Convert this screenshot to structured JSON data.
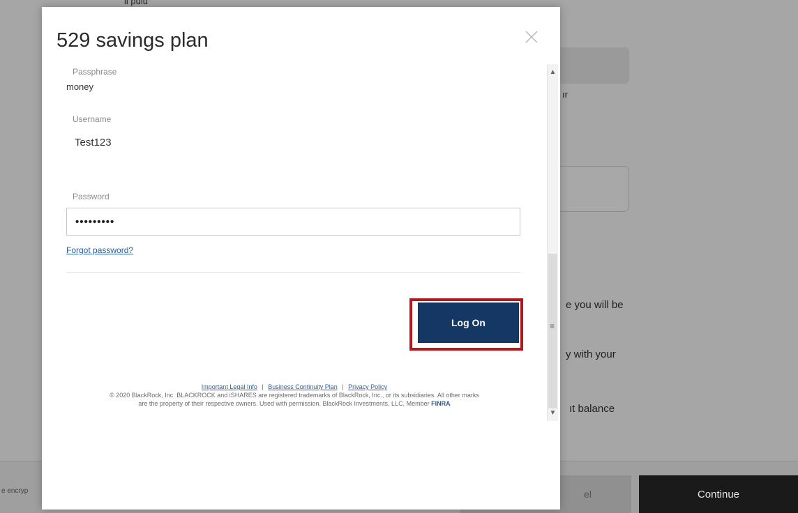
{
  "background": {
    "top_fragment": "ll pulu",
    "fragment_1": "ır",
    "fragment_2": "e you will be",
    "fragment_3": "y with your",
    "fragment_4": "ıt balance",
    "footer_left_fragment": "e encryp",
    "secondary_button_fragment": "el",
    "continue_label": "Continue"
  },
  "modal": {
    "title": "529 savings plan",
    "passphrase_label": "Passphrase",
    "passphrase_value": "money",
    "username_label": "Username",
    "username_value": "Test123",
    "password_label": "Password",
    "password_value": "•••••••••",
    "forgot_password": "Forgot password?",
    "logon_button": "Log On",
    "legal": {
      "link_1": "Important Legal Info",
      "link_2": "Business Continuity Plan",
      "link_3": "Privacy Policy",
      "separator": "|",
      "line_1": "© 2020 BlackRock, Inc. BLACKROCK and iSHARES are registered trademarks of BlackRock, Inc., or its subsidiaries. All other marks",
      "line_2": "are the property of their respective owners. Used with permission. BlackRock Investments, LLC, Member ",
      "finra": "FINRA"
    }
  },
  "icons": {
    "close": "close-icon",
    "scroll_up": "chevron-up-icon",
    "scroll_down": "chevron-down-icon",
    "grip": "scroll-grip-icon"
  },
  "colors": {
    "overlay": "#a6a6a6",
    "primary_button": "#143764",
    "highlight": "#b51818",
    "link": "#2a5d9f",
    "continue_button": "#1a1a1a"
  }
}
